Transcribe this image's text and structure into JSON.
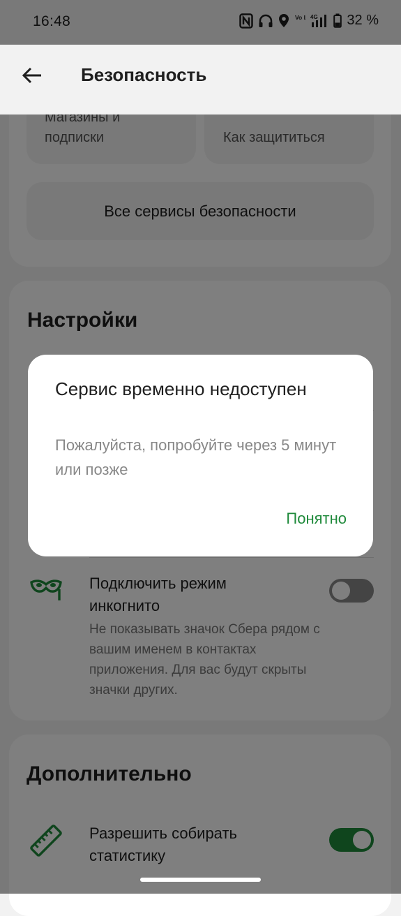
{
  "status_bar": {
    "time": "16:48",
    "battery": "32 %",
    "icons": [
      "nfc-icon",
      "headphones-icon",
      "location-icon",
      "volte-icon",
      "signal-4g-icon",
      "battery-icon"
    ],
    "volte_label": "Vo LTE",
    "network_label": "4G"
  },
  "app_bar": {
    "title": "Безопасность",
    "back_icon": "arrow-back-icon"
  },
  "security_card": {
    "tile_left": "Магазины и подписки",
    "tile_right": "Как защититься",
    "all_services_button": "Все сервисы безопасности"
  },
  "settings_card": {
    "title": "Настройки",
    "incognito": {
      "title": "Подключить режим инкогнито",
      "description": "Не показывать значок Сбера рядом с вашим именем в контактах приложения. Для вас будут скрыты значки других.",
      "enabled": false,
      "icon": "incognito-mask-icon"
    }
  },
  "additional_card": {
    "title": "Дополнительно",
    "statistics": {
      "title": "Разрешить собирать статистику",
      "enabled": true,
      "icon": "ruler-icon"
    }
  },
  "dialog": {
    "title": "Сервис временно недоступен",
    "message": "Пожалуйста, попробуйте через 5 минут или позже",
    "confirm_button": "Понятно"
  },
  "colors": {
    "accent": "#1f8a3b",
    "background": "#f2f2f2",
    "scrim": "rgba(0,0,0,0.5)"
  }
}
